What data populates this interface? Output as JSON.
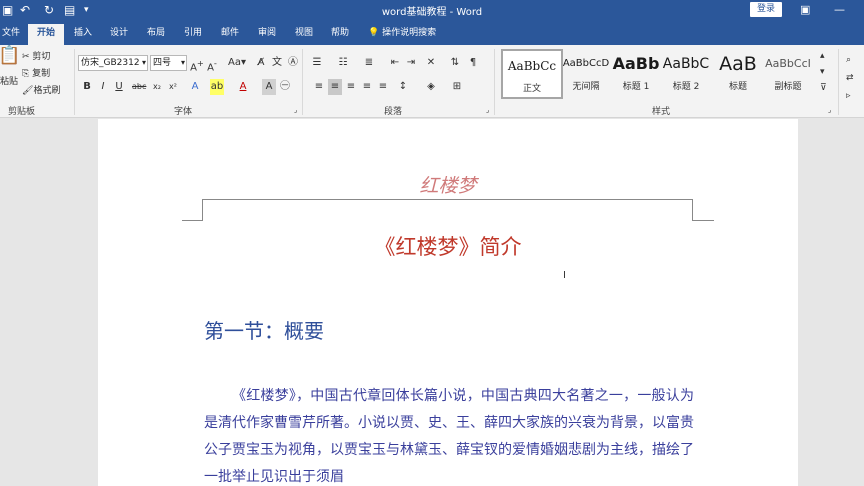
{
  "titlebar": {
    "doc_title": "word基础教程 - Word",
    "login": "登录"
  },
  "tabs": [
    "文件",
    "开始",
    "插入",
    "设计",
    "布局",
    "引用",
    "邮件",
    "审阅",
    "视图",
    "帮助"
  ],
  "tell_me": "操作说明搜索",
  "clipboard": {
    "paste": "粘贴",
    "cut": "剪切",
    "copy": "复制",
    "format_painter": "格式刷",
    "label": "剪贴板"
  },
  "font": {
    "name": "仿宋_GB2312",
    "size": "四号",
    "label": "字体"
  },
  "paragraph": {
    "label": "段落"
  },
  "styles": {
    "label": "样式",
    "items": [
      {
        "sample": "AaBbCc",
        "name": "正文"
      },
      {
        "sample": "AaBbCcD",
        "name": "无间隔"
      },
      {
        "sample": "AaBb",
        "name": "标题 1"
      },
      {
        "sample": "AaBbC",
        "name": "标题 2"
      },
      {
        "sample": "AaB",
        "name": "标题"
      },
      {
        "sample": "AaBbCcI",
        "name": "副标题"
      }
    ]
  },
  "document": {
    "header": "红楼梦",
    "title": "《红楼梦》简介",
    "section_heading": "第一节：概要",
    "paragraph": "《红楼梦》，中国古代章回体长篇小说，中国古典四大名著之一，一般认为是清代作家曹雪芹所著。小说以贾、史、王、薛四大家族的兴衰为背景，以富贵公子贾宝玉为视角，以贾宝玉与林黛玉、薛宝钗的爱情婚姻悲剧为主线，描绘了一批举止见识出于须眉"
  },
  "colors": {
    "ribbon_blue": "#2b579a",
    "header_text": "#d07a7a",
    "title_text": "#c0392b",
    "section_text": "#2f4f9a",
    "body_text": "#3a3f9c"
  }
}
